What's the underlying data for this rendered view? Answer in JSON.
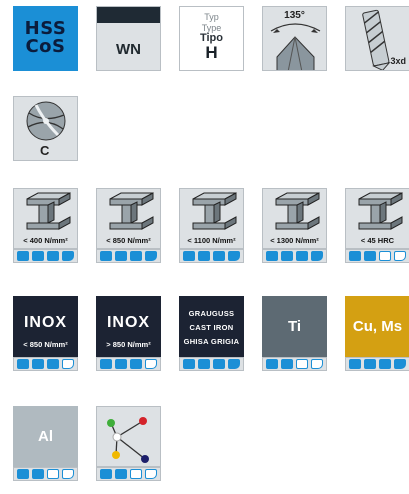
{
  "row1": {
    "material_tag": {
      "line1": "HSS",
      "line2": "CoS"
    },
    "wn_tag": "WN",
    "type_tag": {
      "line1": "Typ",
      "line2": "Type",
      "line3": "Tipo",
      "line4": "H"
    },
    "angle_tag": "135°",
    "depth_tag": "3xd"
  },
  "row2": {
    "cutting_tag": "C"
  },
  "strength_tiles": [
    {
      "label": "< 400 N/mm²",
      "level": 4
    },
    {
      "label": "< 850 N/mm²",
      "level": 4
    },
    {
      "label": "< 1100 N/mm²",
      "level": 4
    },
    {
      "label": "< 1300 N/mm²",
      "level": 4
    },
    {
      "label": "< 45 HRC",
      "level": 2
    }
  ],
  "material_tiles": [
    {
      "name": "INOX",
      "sub": "< 850 N/mm²",
      "level": 3
    },
    {
      "name": "INOX",
      "sub": "> 850 N/mm²",
      "level": 3
    },
    {
      "line1": "GRAUGUSS",
      "line2": "CAST IRON",
      "line3": "GHISA GRIGIA",
      "level": 4
    },
    {
      "name": "Ti",
      "level": 2
    },
    {
      "name": "Cu, Ms",
      "level": 4
    }
  ],
  "last_tiles": [
    {
      "name": "Al",
      "level": 2
    },
    {
      "icon": "plastics-icon",
      "level": 2
    }
  ],
  "colors": {
    "accent_blue": "#1b8fd6",
    "navy": "#1c2333",
    "slate": "#5d6a73",
    "gold": "#d4a012",
    "silver": "#b0bac0"
  }
}
